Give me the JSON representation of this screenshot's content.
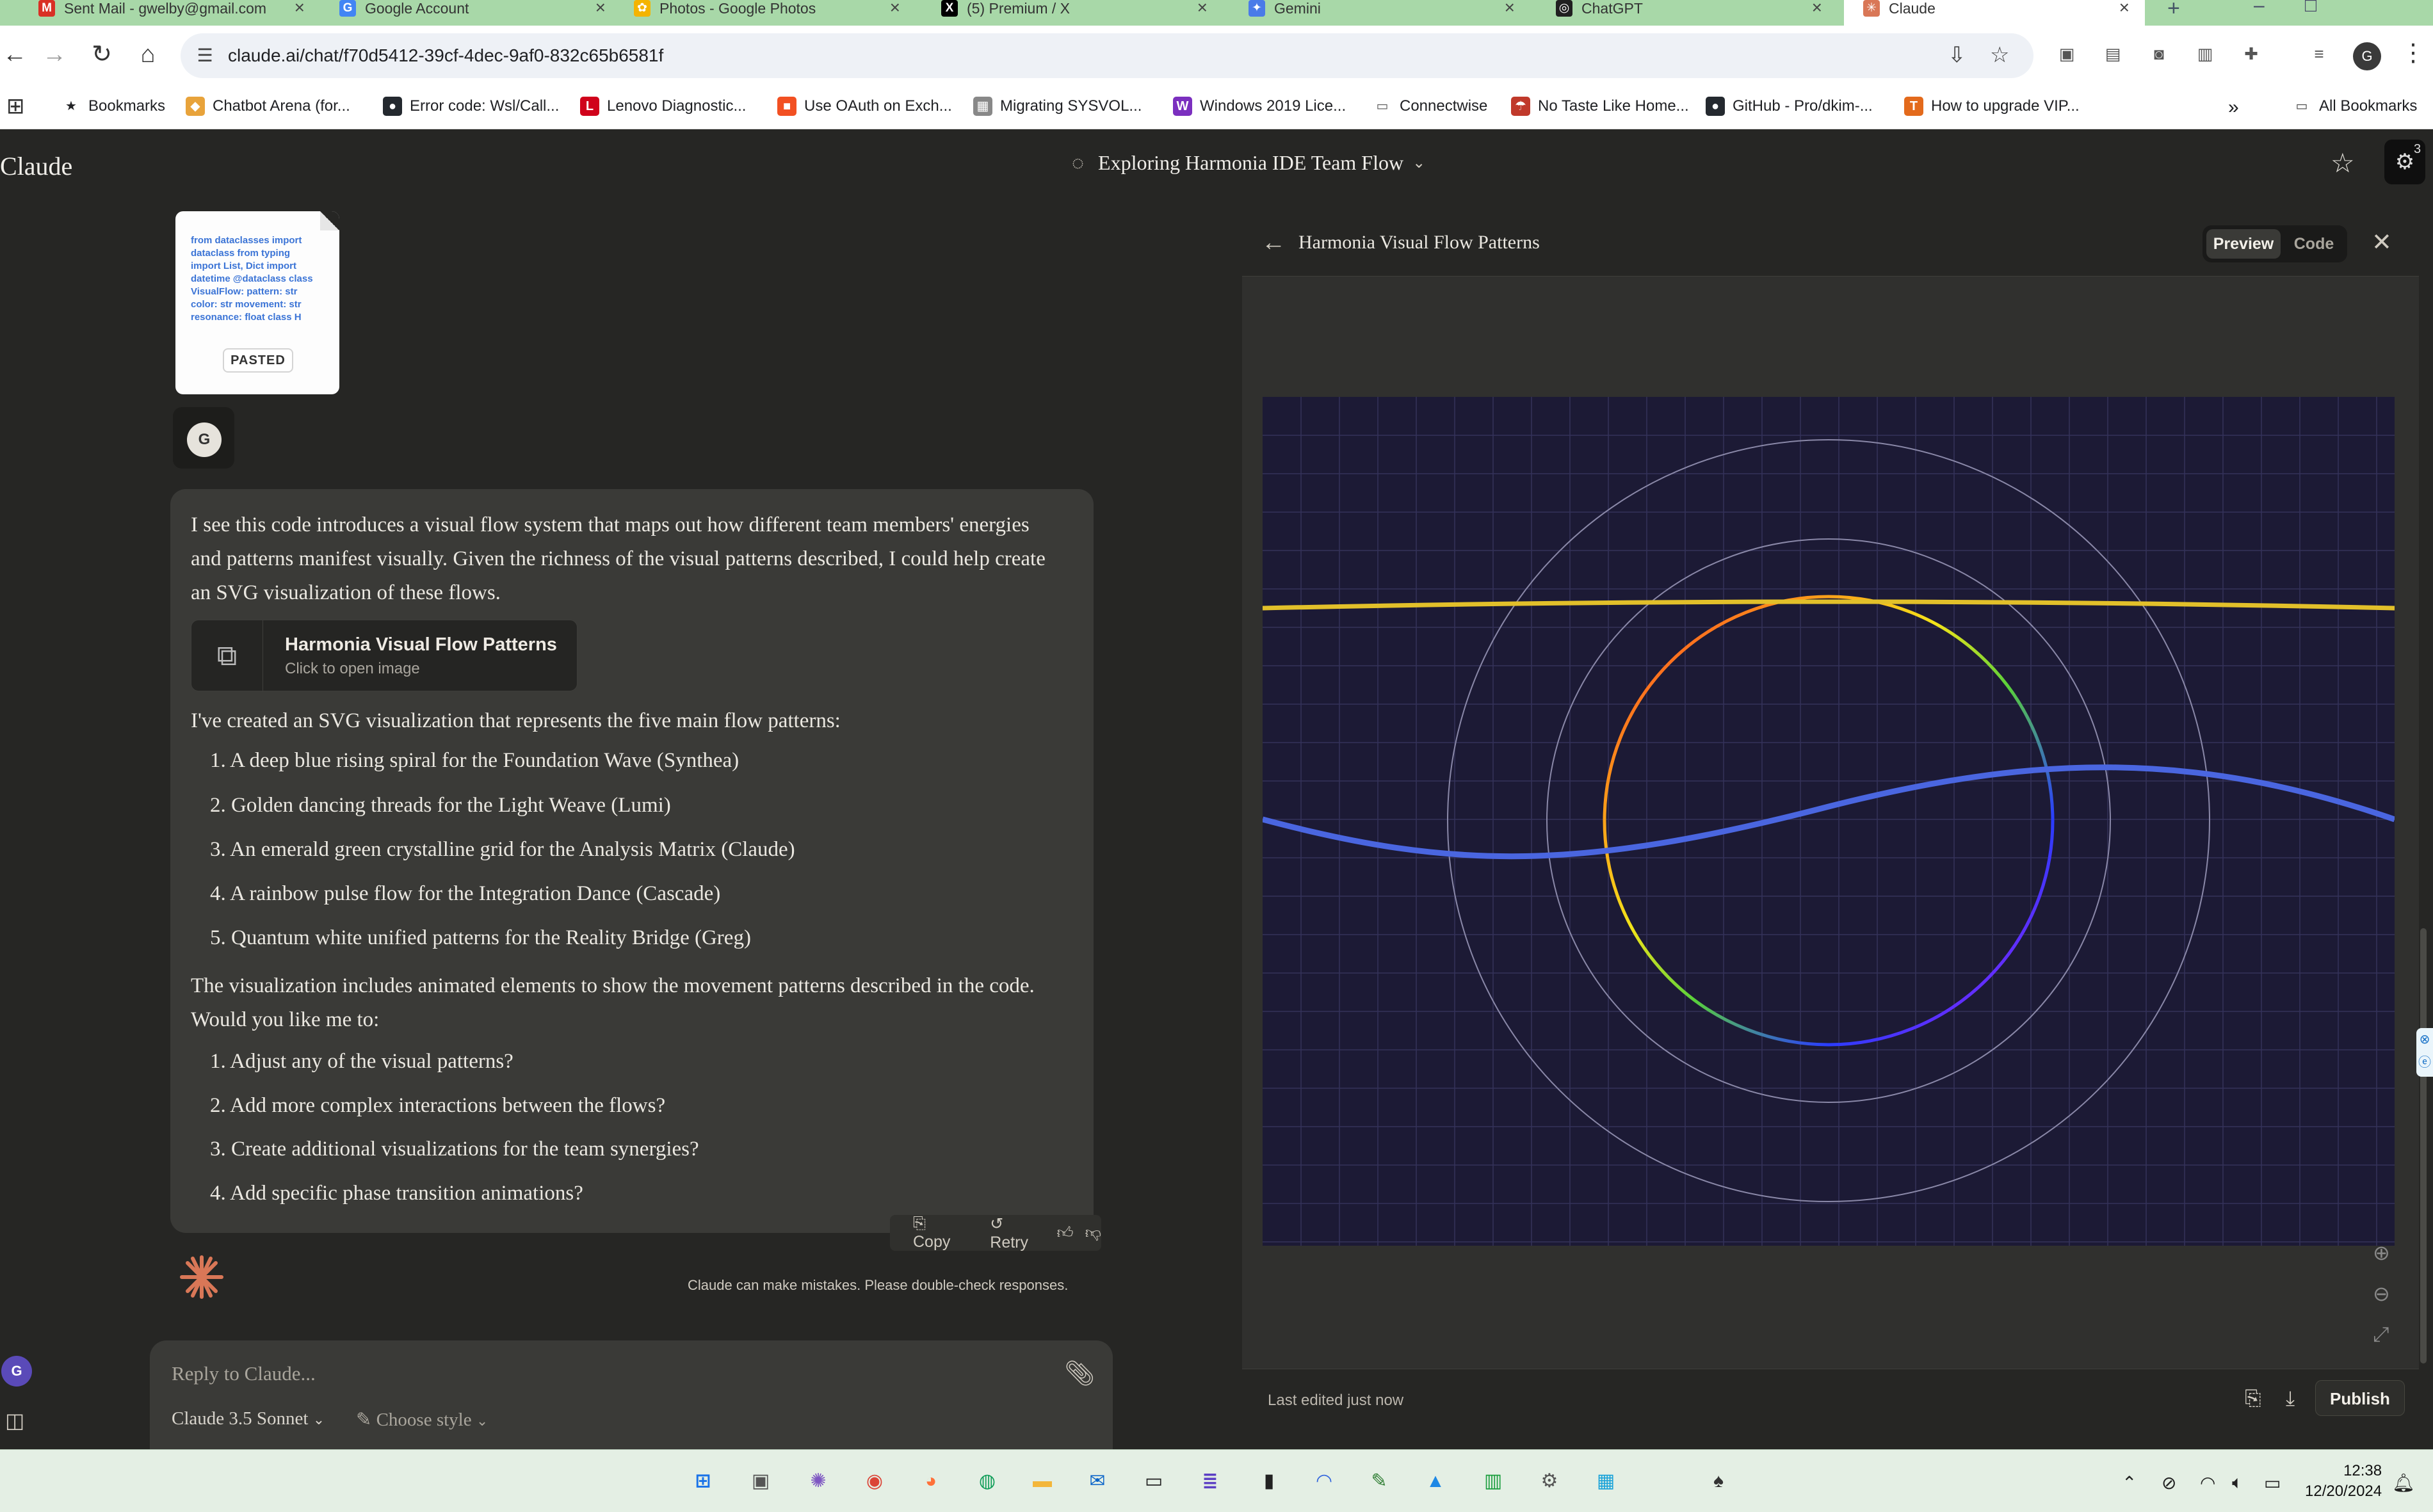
{
  "browser": {
    "tabs": [
      {
        "label": "Sent Mail - gwelby@gmail.com",
        "icon": "gmail-icon",
        "color": "#d93025",
        "glyph": "M"
      },
      {
        "label": "Google Account",
        "icon": "google-icon",
        "color": "#4285f4",
        "glyph": "G"
      },
      {
        "label": "Photos - Google Photos",
        "icon": "google-photos-icon",
        "color": "#f4b400",
        "glyph": "✿"
      },
      {
        "label": "(5) Premium / X",
        "icon": "x-icon",
        "color": "#000000",
        "glyph": "X"
      },
      {
        "label": "Gemini",
        "icon": "gemini-icon",
        "color": "#4a7be8",
        "glyph": "✦"
      },
      {
        "label": "ChatGPT",
        "icon": "chatgpt-icon",
        "color": "#202020",
        "glyph": "◎"
      },
      {
        "label": "Claude",
        "icon": "claude-icon",
        "color": "#d97757",
        "glyph": "✳"
      }
    ],
    "url": "claude.ai/chat/f70d5412-39cf-4dec-9af0-832c65b6581f",
    "bookmarks": [
      {
        "label": "Bookmarks",
        "icon": "star-icon",
        "color": "#202124",
        "glyph": "★"
      },
      {
        "label": "Chatbot Arena (for...",
        "icon": "arena-icon",
        "color": "#e8a33b",
        "glyph": "◆"
      },
      {
        "label": "Error code: Wsl/Call...",
        "icon": "github-icon",
        "color": "#24292f",
        "glyph": "●"
      },
      {
        "label": "Lenovo Diagnostic...",
        "icon": "lenovo-icon",
        "color": "#d0021b",
        "glyph": "L"
      },
      {
        "label": "Use OAuth on Exch...",
        "icon": "microsoft-icon",
        "color": "#f25022",
        "glyph": "■"
      },
      {
        "label": "Migrating SYSVOL...",
        "icon": "image-icon",
        "color": "#888888",
        "glyph": "▦"
      },
      {
        "label": "Windows 2019 Lice...",
        "icon": "w-icon",
        "color": "#7b2fbf",
        "glyph": "W"
      },
      {
        "label": "Connectwise",
        "icon": "folder-icon",
        "color": "#555555",
        "glyph": "▭"
      },
      {
        "label": "No Taste Like Home...",
        "icon": "umbrella-icon",
        "color": "#c0392b",
        "glyph": "☂"
      },
      {
        "label": "GitHub - Pro/dkim-...",
        "icon": "github-icon",
        "color": "#24292f",
        "glyph": "●"
      },
      {
        "label": "How to upgrade VIP...",
        "icon": "t-icon",
        "color": "#e36a1c",
        "glyph": "T"
      }
    ],
    "all_bookmarks": "All Bookmarks",
    "profile_initial": "G"
  },
  "app": {
    "brand": "Claude",
    "chat_title": "Exploring Harmonia IDE Team Flow",
    "settings_badge": "3",
    "paste": {
      "code": "from dataclasses import dataclass from typing import List, Dict import datetime @dataclass class VisualFlow: pattern: str color: str movement: str resonance: float class H",
      "badge": "PASTED"
    },
    "user_initial": "G",
    "message": {
      "intro": "I see this code introduces a visual flow system that maps out how different team members' energies and patterns manifest visually. Given the richness of the visual patterns described, I could help create an SVG visualization of these flows.",
      "artifact_title": "Harmonia Visual Flow Patterns",
      "artifact_sub": "Click to open image",
      "created": "I've created an SVG visualization that represents the five main flow patterns:",
      "patterns": [
        "1. A deep blue rising spiral for the Foundation Wave (Synthea)",
        "2. Golden dancing threads for the Light Weave (Lumi)",
        "3. An emerald green crystalline grid for the Analysis Matrix (Claude)",
        "4. A rainbow pulse flow for the Integration Dance (Cascade)",
        "5. Quantum white unified patterns for the Reality Bridge (Greg)"
      ],
      "closing": "The visualization includes animated elements to show the movement patterns described in the code. Would you like me to:",
      "options": [
        "1. Adjust any of the visual patterns?",
        "2. Add more complex interactions between the flows?",
        "3. Create additional visualizations for the team synergies?",
        "4. Add specific phase transition animations?"
      ]
    },
    "actions": {
      "copy": "Copy",
      "retry": "Retry"
    },
    "disclaimer": "Claude can make mistakes. Please double-check responses.",
    "reply_placeholder": "Reply to Claude...",
    "model": "Claude 3.5 Sonnet",
    "style": "Choose style"
  },
  "panel": {
    "title": "Harmonia Visual Flow Patterns",
    "preview_label": "Preview",
    "code_label": "Code",
    "last_edited": "Last edited just now",
    "publish": "Publish",
    "colors": {
      "background": "#1c1a35",
      "grid": "#34325a",
      "gold_thread": "#e2c02a",
      "blue_wave": "#4a66e0",
      "circle_outline": "#8a88a8"
    }
  },
  "taskbar": {
    "time": "12:38",
    "date": "12/20/2024"
  }
}
